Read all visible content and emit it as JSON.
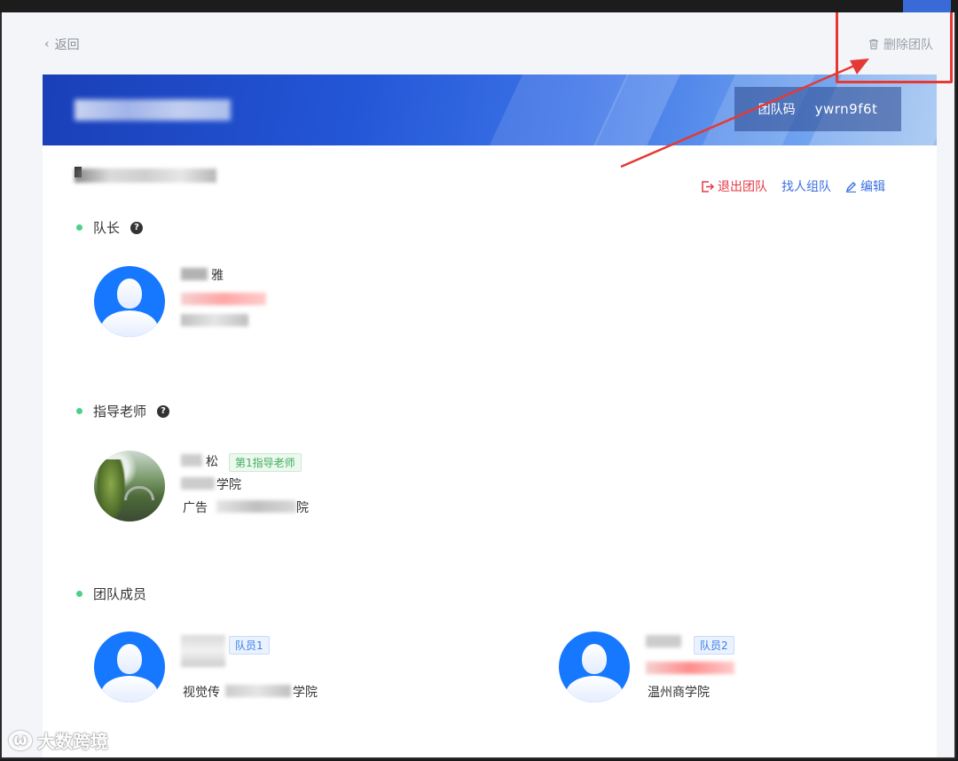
{
  "header": {
    "back_label": "返回",
    "delete_label": "删除团队"
  },
  "banner": {
    "team_code_label": "团队码",
    "team_code_value": "ywrn9f6t"
  },
  "actions": {
    "quit_label": "退出团队",
    "find_label": "找人组队",
    "edit_label": "编辑"
  },
  "captain": {
    "section_title": "队长",
    "name_fragment": "雅"
  },
  "advisor": {
    "section_title": "指导老师",
    "name_fragment": "松",
    "tag": "第1指导老师",
    "school_fragment": "学院",
    "major_prefix": "广告",
    "major_suffix": "院"
  },
  "members": {
    "section_title": "团队成员",
    "list": [
      {
        "tag": "队员1",
        "school": "视觉传",
        "school_suffix": "学院"
      },
      {
        "tag": "队员2",
        "school": "温州商学院"
      }
    ]
  },
  "watermark": {
    "text": "大数跨境"
  },
  "colors": {
    "accent_blue": "#3b6fe0",
    "danger_red": "#e53946",
    "green_dot": "#4cd18a",
    "annotation_red": "#e53935"
  }
}
